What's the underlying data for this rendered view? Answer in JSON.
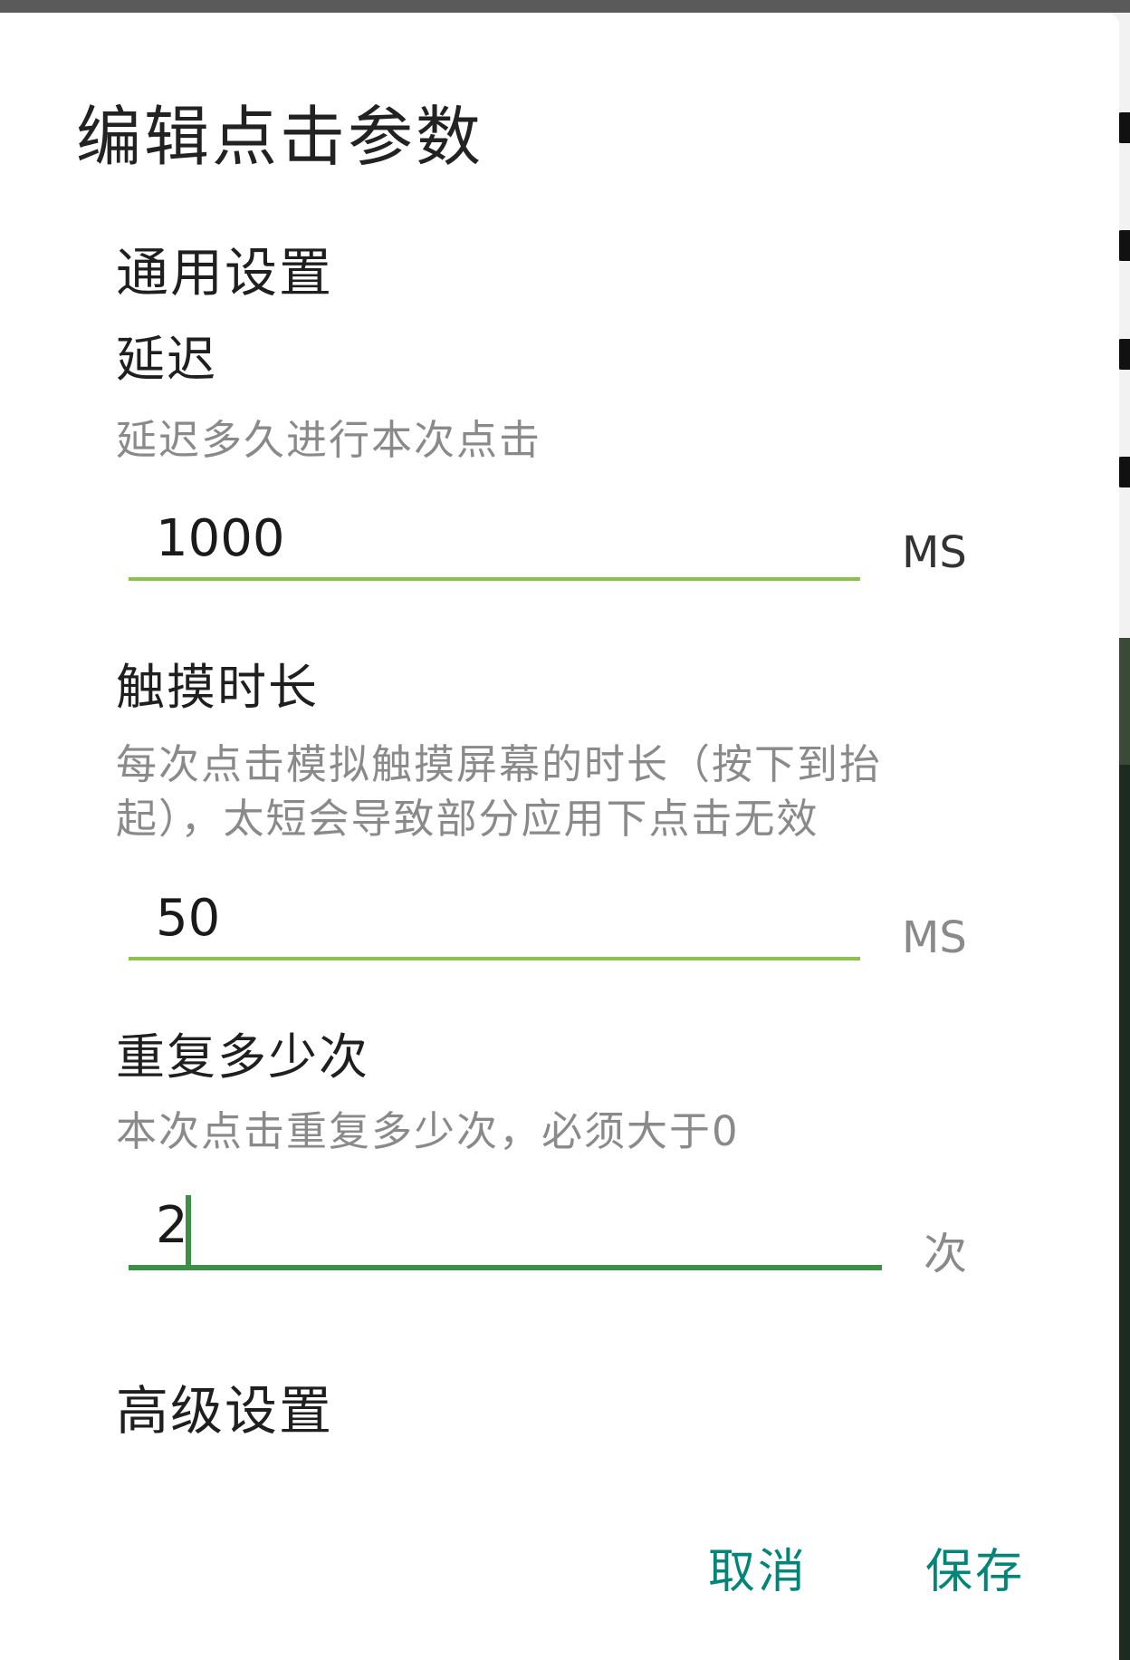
{
  "dialog": {
    "title": "编辑点击参数"
  },
  "general_section": {
    "heading": "通用设置"
  },
  "delay": {
    "title": "延迟",
    "description": "延迟多久进行本次点击",
    "value": "1000",
    "unit": "MS"
  },
  "touch_duration": {
    "title": "触摸时长",
    "description": "每次点击模拟触摸屏幕的时长（按下到抬起），太短会导致部分应用下点击无效",
    "value": "50",
    "unit": "MS"
  },
  "repeat": {
    "title": "重复多少次",
    "description": "本次点击重复多少次，必须大于0",
    "value": "2",
    "unit": "次"
  },
  "advanced_section": {
    "heading": "高级设置"
  },
  "actions": {
    "cancel_label": "取消",
    "save_label": "保存"
  },
  "colors": {
    "accent": "#008577",
    "underline": "#8bc34a",
    "focused_underline": "#3d8f45",
    "description_text": "#8a8a8a"
  }
}
